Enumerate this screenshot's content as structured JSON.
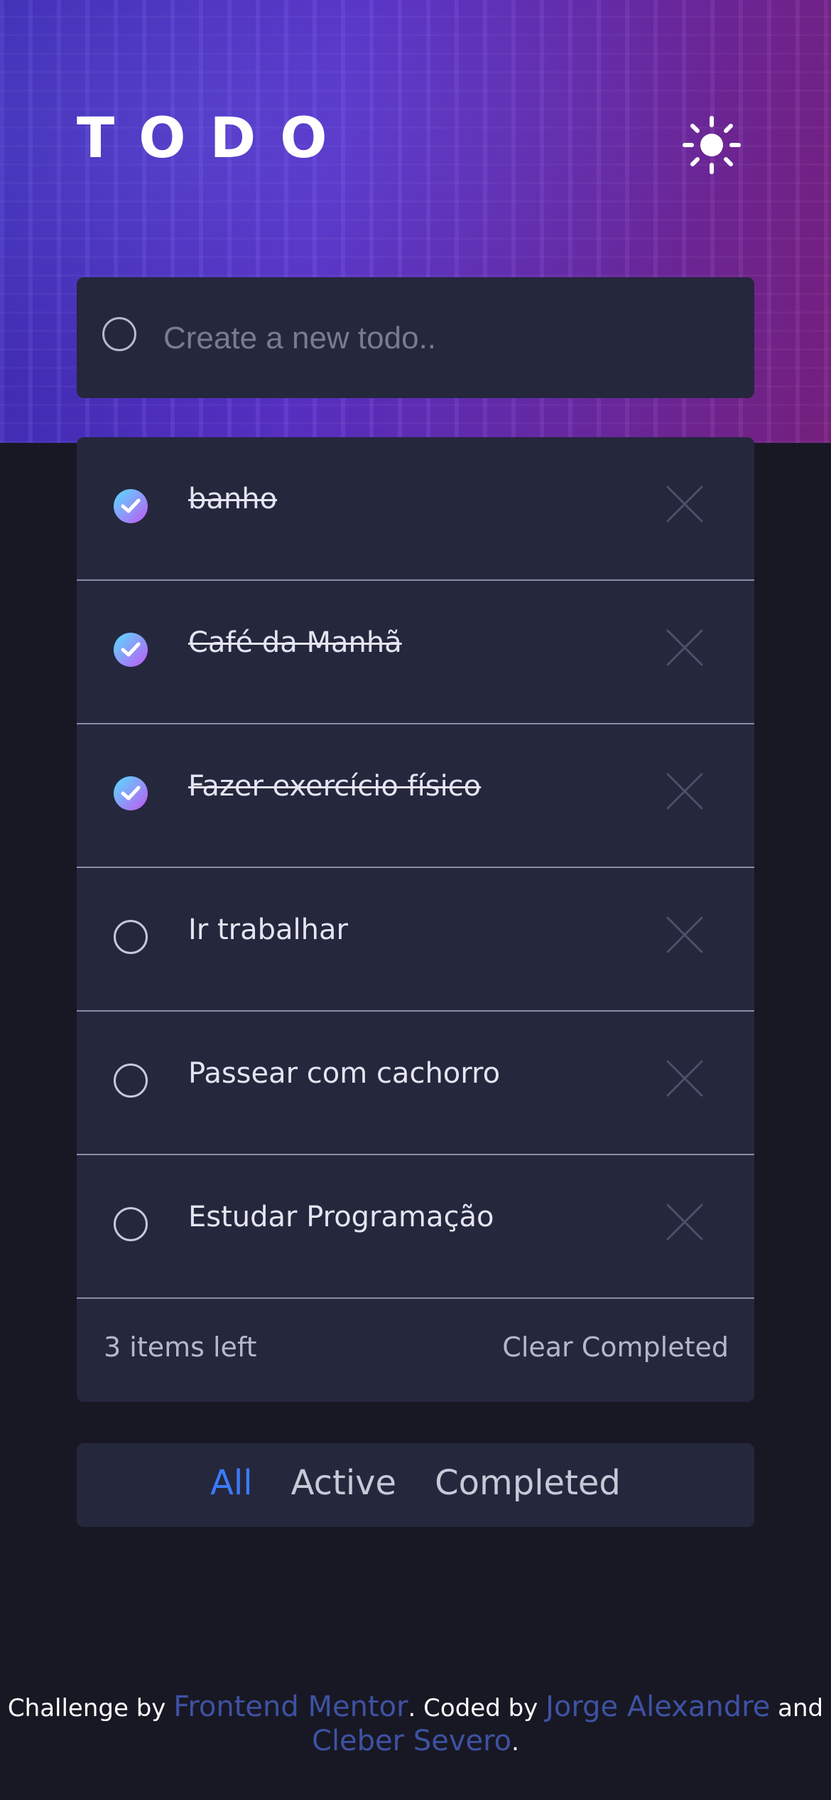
{
  "app": {
    "title": "TODO"
  },
  "new_todo": {
    "placeholder": "Create a new todo.."
  },
  "todos": [
    {
      "text": "banho",
      "completed": true
    },
    {
      "text": "Café da Manhã",
      "completed": true
    },
    {
      "text": "Fazer exercício físico",
      "completed": true
    },
    {
      "text": "Ir trabalhar",
      "completed": false
    },
    {
      "text": "Passear com cachorro",
      "completed": false
    },
    {
      "text": "Estudar Programação",
      "completed": false
    }
  ],
  "footer": {
    "items_left": "3 items left",
    "clear_label": "Clear Completed"
  },
  "filters": {
    "all": "All",
    "active": "Active",
    "completed": "Completed",
    "selected": "All"
  },
  "credits": {
    "prefix": "Challenge by",
    "mentor": "Frontend Mentor",
    "coded_by": ". Coded by",
    "author1": "Jorge Alexandre",
    "and": "and",
    "author2": "Cleber Severo",
    "suffix": "."
  },
  "colors": {
    "background": "#181824",
    "card": "#25273d",
    "accent": "#3a7bfd",
    "check_gradient_start": "#57ddff",
    "check_gradient_end": "#c058f3",
    "link": "#3e52a3"
  },
  "icons": {
    "theme": "sun-icon",
    "delete": "close-icon",
    "check": "check-icon"
  }
}
